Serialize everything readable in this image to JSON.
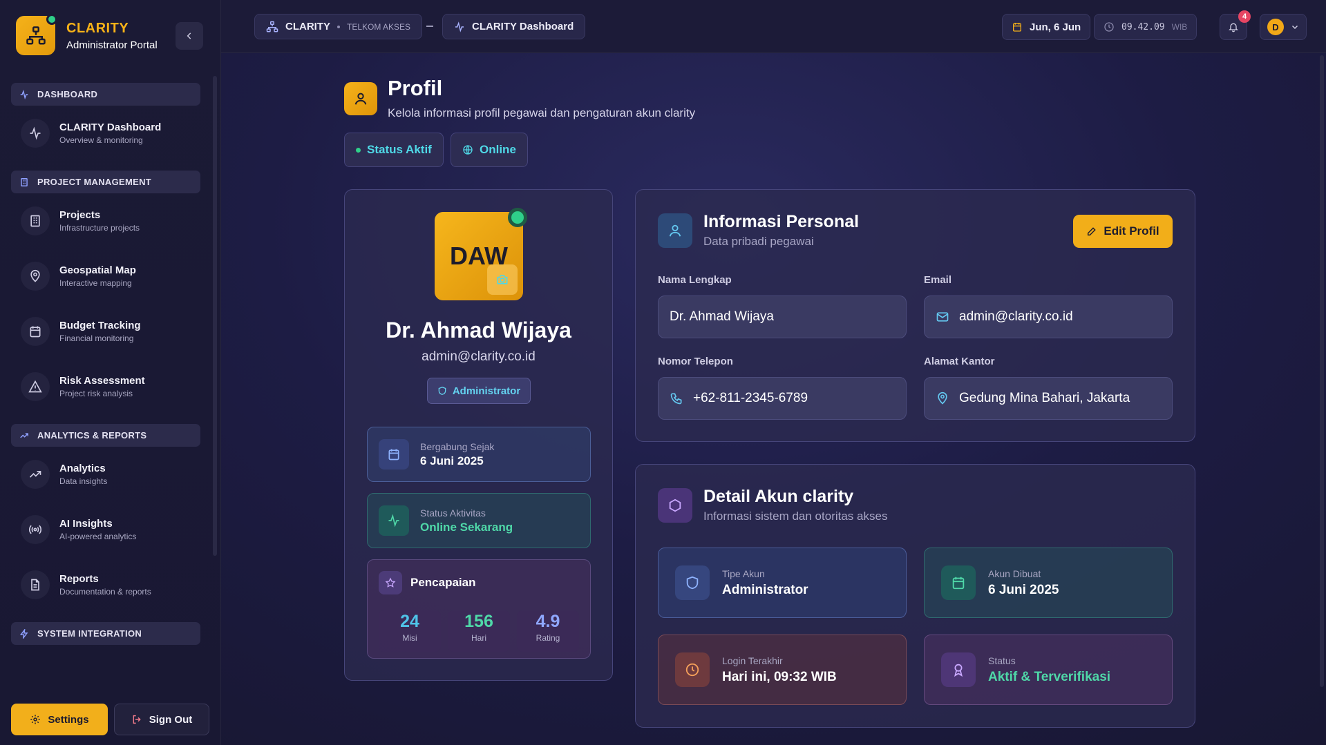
{
  "brand": {
    "name": "CLARITY",
    "subtitle": "Administrator Portal"
  },
  "sidebar": {
    "sections": [
      {
        "label": "DASHBOARD",
        "icon": "activity-icon",
        "items": [
          {
            "title": "CLARITY Dashboard",
            "desc": "Overview & monitoring",
            "icon": "activity-icon"
          }
        ]
      },
      {
        "label": "PROJECT MANAGEMENT",
        "icon": "building-icon",
        "items": [
          {
            "title": "Projects",
            "desc": "Infrastructure projects",
            "icon": "building-icon"
          },
          {
            "title": "Geospatial Map",
            "desc": "Interactive mapping",
            "icon": "map-pin-icon"
          },
          {
            "title": "Budget Tracking",
            "desc": "Financial monitoring",
            "icon": "calendar-icon"
          },
          {
            "title": "Risk Assessment",
            "desc": "Project risk analysis",
            "icon": "warning-icon"
          }
        ]
      },
      {
        "label": "ANALYTICS & REPORTS",
        "icon": "trending-up-icon",
        "items": [
          {
            "title": "Analytics",
            "desc": "Data insights",
            "icon": "trending-up-icon"
          },
          {
            "title": "AI Insights",
            "desc": "AI-powered analytics",
            "icon": "broadcast-icon"
          },
          {
            "title": "Reports",
            "desc": "Documentation & reports",
            "icon": "document-icon"
          }
        ]
      },
      {
        "label": "SYSTEM INTEGRATION",
        "icon": "bolt-icon",
        "items": []
      }
    ],
    "footer": {
      "settings": "Settings",
      "signout": "Sign Out"
    }
  },
  "topbar": {
    "crumb_app": "CLARITY",
    "crumb_org": "TELKOM AKSES",
    "crumb_page": "CLARITY Dashboard",
    "date": "Jun, 6 Jun",
    "time": "09.42.09",
    "timezone": "WIB",
    "notifications": "4",
    "user_initial": "D"
  },
  "page": {
    "title": "Profil",
    "subtitle": "Kelola informasi profil pegawai dan pengaturan akun clarity",
    "status_active": "Status Aktif",
    "status_online": "Online"
  },
  "profile": {
    "initials": "DAW",
    "name": "Dr. Ahmad Wijaya",
    "email": "admin@clarity.co.id",
    "role": "Administrator",
    "joined_label": "Bergabung Sejak",
    "joined_value": "6 Juni 2025",
    "activity_label": "Status Aktivitas",
    "activity_value": "Online Sekarang",
    "achievements": {
      "title": "Pencapaian",
      "stats": [
        {
          "value": "24",
          "label": "Misi",
          "color": "#4fc3e8"
        },
        {
          "value": "156",
          "label": "Hari",
          "color": "#4fd8a8"
        },
        {
          "value": "4.9",
          "label": "Rating",
          "color": "#8fa7ff"
        }
      ]
    }
  },
  "personal": {
    "title": "Informasi Personal",
    "subtitle": "Data pribadi pegawai",
    "edit_label": "Edit Profil",
    "fields": {
      "name_label": "Nama Lengkap",
      "name_value": "Dr. Ahmad Wijaya",
      "email_label": "Email",
      "email_value": "admin@clarity.co.id",
      "phone_label": "Nomor Telepon",
      "phone_value": "+62-811-2345-6789",
      "office_label": "Alamat Kantor",
      "office_value": "Gedung Mina Bahari, Jakarta"
    }
  },
  "account": {
    "title": "Detail Akun clarity",
    "subtitle": "Informasi sistem dan otoritas akses",
    "tiles": {
      "type_label": "Tipe Akun",
      "type_value": "Administrator",
      "created_label": "Akun Dibuat",
      "created_value": "6 Juni 2025",
      "login_label": "Login Terakhir",
      "login_value": "Hari ini, 09:32 WIB",
      "status_label": "Status",
      "status_value": "Aktif & Terverifikasi"
    }
  },
  "colors": {
    "accent": "#f2ae19",
    "online": "#2fd08a",
    "cyan": "#4fd8e6"
  }
}
